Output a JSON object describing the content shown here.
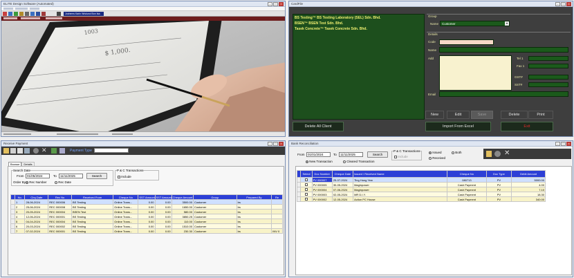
{
  "w1": {
    "title": "ELITE Design Software (Automated)",
    "banner": "Jochems Karin Wiskund Bon faa"
  },
  "card": {
    "title": "CardFile",
    "companies": [
      "BS Testing™ BS Testing Laboratory (SEL) Sdn. Bhd.",
      "BSEN™ BSEN Test Sdn. Bhd.",
      "Tasek Concrete™ Tasek Concrete Sdn. Bhd."
    ],
    "group_label": "Group",
    "name_label": "Name",
    "name_value": "Customer",
    "details_label": "Details",
    "code_label": "Code",
    "name2_label": "Name",
    "addr_label": "Add",
    "tel_label": "Tel 1",
    "fax_label": "Fax 1",
    "gst_label": "GST#",
    "sst_label": "SST#",
    "email_label": "Email",
    "buttons": {
      "new": "New",
      "edit": "Edit",
      "save": "Save",
      "delete": "Delete",
      "print": "Print",
      "import": "Import From Excel",
      "delete_all": "Delete All Client",
      "exit": "Exit"
    }
  },
  "receive": {
    "title": "Receive Payment",
    "payment_type_label": "Payment Type",
    "tabs": [
      "Browse",
      "Details"
    ],
    "search_date_label": "Search Date",
    "from_label": "From",
    "from_value": "01/05/2024",
    "to_label": "To",
    "to_value": "11/11/2025",
    "search_btn": "Search",
    "order_by_label": "Order By",
    "opt_rec": "Rec Number",
    "opt_date": "Rec Date",
    "pc_label": "P & C Transactions",
    "include_label": "Include",
    "columns": [
      "No.",
      "Chq Date",
      "Rec No",
      "Received From",
      "Cheque No",
      "SST Amount",
      "SST Amount",
      "Cheque Amount",
      "Group",
      "Prepared By",
      "Re"
    ],
    "rows": [
      [
        "1",
        "28-06-2024",
        "REC 000006",
        "BS Testing",
        "Online Trans...",
        "0.00",
        "0.00",
        "3500.00",
        "Customer",
        "bs",
        ""
      ],
      [
        "2",
        "25-06-2024",
        "REC 000008",
        "BS Testing",
        "Online Trans...",
        "0.00",
        "0.00",
        "1650.00",
        "Customer",
        "bs",
        ""
      ],
      [
        "3",
        "20-05-2024",
        "REC 000004",
        "BSEN Test",
        "Online Trans...",
        "0.00",
        "0.00",
        "580.00",
        "Customer",
        "bs",
        ""
      ],
      [
        "4",
        "12-06-2024",
        "REC 000001",
        "BS Testing",
        "Online Trans...",
        "0.00",
        "0.00",
        "3850.25",
        "Customer",
        "bs",
        ""
      ],
      [
        "5",
        "04-04-2024",
        "REC 000004",
        "BS Testing",
        "Online Trans...",
        "0.00",
        "0.00",
        "110.00",
        "Customer",
        "bs",
        ""
      ],
      [
        "6",
        "20-03-2024",
        "REC 000002",
        "BS Testing",
        "Online Trans...",
        "0.00",
        "0.00",
        "1510.00",
        "Customer",
        "bs",
        ""
      ],
      [
        "7",
        "07-02-2024",
        "REC 000001",
        "BS Testing",
        "Online Trans...",
        "0.00",
        "0.00",
        "230.30",
        "Customer",
        "bs",
        "INV 0"
      ]
    ]
  },
  "bank": {
    "title": "Bank Reconciliation",
    "from_label": "From",
    "from_value": "01/01/2024",
    "to_label": "To",
    "to_value": "11/11/2025",
    "search_btn": "Search",
    "new_tx": "New Transaction",
    "cleared_tx": "Cleared Transaction",
    "pc_label": "P & C Transactions",
    "include_label": "Include",
    "issued": "Issued",
    "received": "Received",
    "both": "Both",
    "columns": [
      "Select",
      "Doc Number",
      "Cheque Date",
      "Issued / Received Name",
      "Cheque No",
      "Doc Type",
      "Debit Amount"
    ],
    "rows": [
      [
        "PV 000007",
        "25-07-2024",
        "Ting Hong Yew",
        "080713",
        "PV",
        "5000.00"
      ],
      [
        "PV 000005",
        "30-05-2024",
        "Maginpower",
        "Cash Payment",
        "PV",
        "4.00"
      ],
      [
        "PV 000004",
        "07-06-2024",
        "Maginpower",
        "Cash Payment",
        "PV",
        "7.10"
      ],
      [
        "PV 000003",
        "02-05-2024",
        "MR D.I.Y.",
        "Cash Payment",
        "PV",
        "18.30"
      ],
      [
        "PV 000002",
        "12-05-2024",
        "Action PC House",
        "Cash Payment",
        "PV",
        "340.00"
      ]
    ]
  }
}
